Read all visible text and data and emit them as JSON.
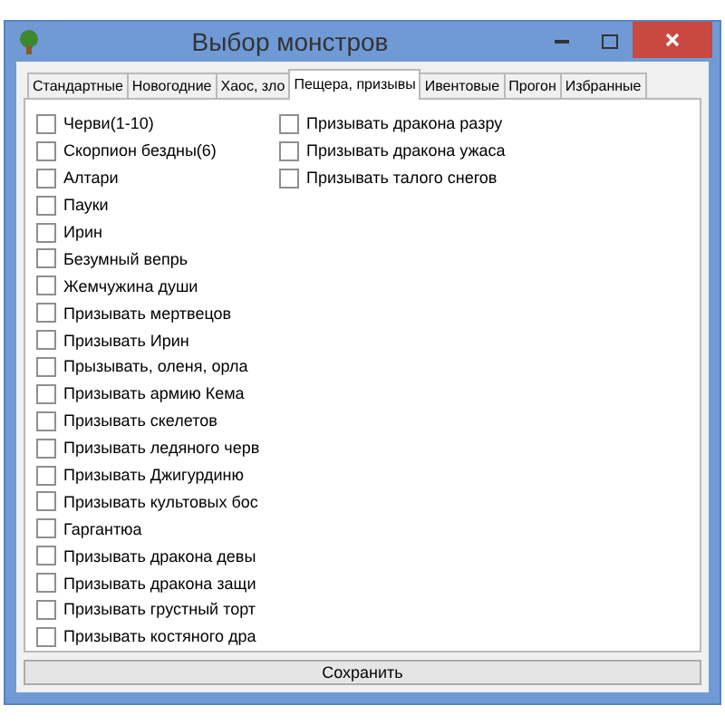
{
  "window": {
    "title": "Выбор монстров"
  },
  "tabs": [
    {
      "label": "Стандартные",
      "selected": false
    },
    {
      "label": "Новогодние",
      "selected": false
    },
    {
      "label": "Хаос, зло",
      "selected": false
    },
    {
      "label": "Пещера, призывы",
      "selected": true
    },
    {
      "label": "Ивентовые",
      "selected": false
    },
    {
      "label": "Прогон",
      "selected": false
    },
    {
      "label": "Избранные",
      "selected": false
    }
  ],
  "columns": [
    [
      {
        "label": "Черви(1-10)",
        "checked": false
      },
      {
        "label": "Скорпион бездны(6)",
        "checked": false
      },
      {
        "label": "Алтари",
        "checked": false
      },
      {
        "label": "Пауки",
        "checked": false
      },
      {
        "label": "Ирин",
        "checked": false
      },
      {
        "label": "Безумный вепрь",
        "checked": false
      },
      {
        "label": "Жемчужина души",
        "checked": false
      },
      {
        "label": "Призывать мертвецов",
        "checked": false
      },
      {
        "label": "Призывать Ирин",
        "checked": false
      },
      {
        "label": "Прызывать, оленя, орла",
        "checked": false
      },
      {
        "label": "Призывать армию Кема",
        "checked": false
      },
      {
        "label": "Призывать скелетов",
        "checked": false
      },
      {
        "label": "Призывать ледяного черв",
        "checked": false
      },
      {
        "label": "Призывать Джигурдиню",
        "checked": false
      },
      {
        "label": "Призывать культовых бос",
        "checked": false
      },
      {
        "label": "Гаргантюа",
        "checked": false
      },
      {
        "label": "Призывать дракона девы",
        "checked": false
      },
      {
        "label": "Призывать дракона защи",
        "checked": false
      },
      {
        "label": "Призывать грустный торт",
        "checked": false
      },
      {
        "label": "Призывать костяного дра",
        "checked": false
      }
    ],
    [
      {
        "label": "Призывать дракона разру",
        "checked": false
      },
      {
        "label": "Призывать дракона ужаса",
        "checked": false
      },
      {
        "label": "Призывать талого снегов",
        "checked": false
      }
    ]
  ],
  "save_button": "Сохранить"
}
